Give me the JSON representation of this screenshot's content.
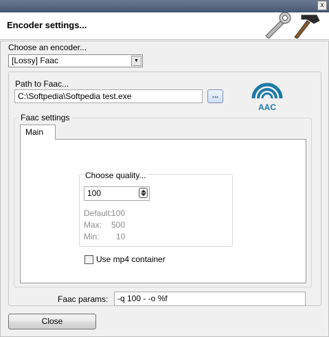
{
  "window": {
    "title": "Encoder settings...",
    "close_glyph": "x"
  },
  "encoder": {
    "label": "Choose an encoder...",
    "selected": "[Lossy] Faac"
  },
  "path": {
    "label": "Path to Faac...",
    "value": "C:\\Softpedia\\Softpedia test.exe",
    "browse_label": "..."
  },
  "logo": {
    "text": "AAC",
    "color": "#1b7aa8"
  },
  "faac_settings": {
    "group_title": "Faac settings",
    "tabs": [
      {
        "label": "Main"
      }
    ],
    "quality": {
      "title": "Choose quality...",
      "value": "100",
      "default_label": "Default:",
      "default_value": "100",
      "max_label": "Max:",
      "max_value": "500",
      "min_label": "Min:",
      "min_value": "10"
    },
    "mp4": {
      "label": "Use mp4 container",
      "checked": false
    }
  },
  "params": {
    "label": "Faac params:",
    "value": "-q 100 - -o %f"
  },
  "footer": {
    "close_label": "Close"
  },
  "icons": [
    "tools-icon",
    "close-icon",
    "aac-logo-icon",
    "dropdown-arrow-icon",
    "spin-up-icon",
    "spin-down-icon"
  ]
}
